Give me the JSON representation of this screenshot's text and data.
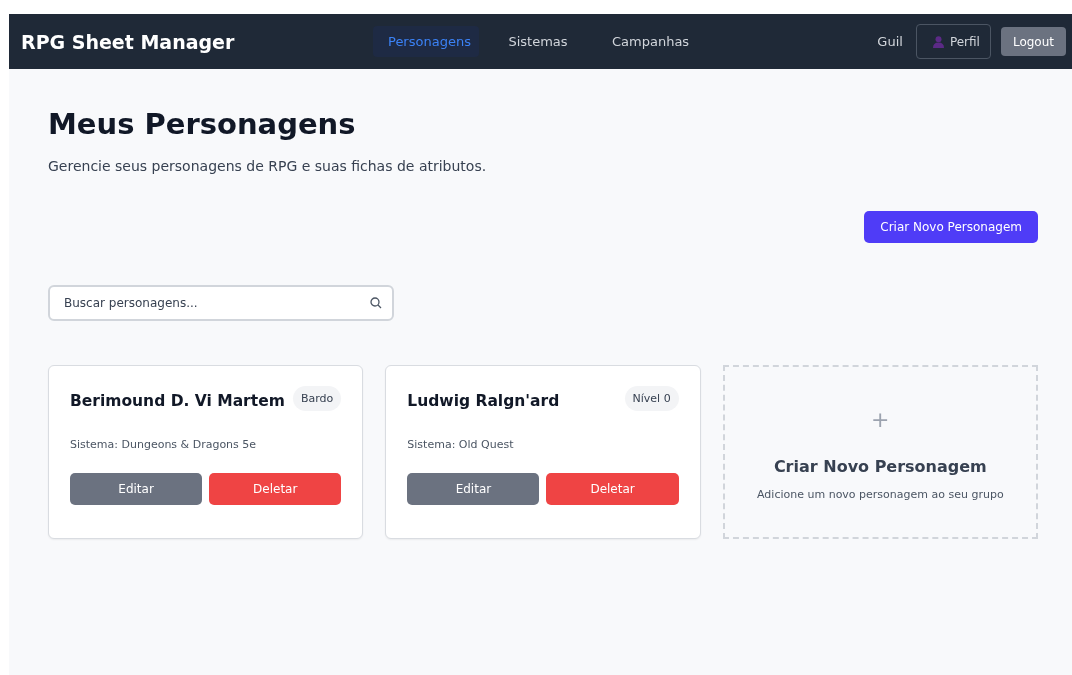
{
  "navbar": {
    "brand": "RPG Sheet Manager",
    "links": [
      {
        "label": "Personagens",
        "selected": true
      },
      {
        "label": "Sistemas",
        "selected": false
      },
      {
        "label": "Campanhas",
        "selected": false
      }
    ],
    "user": "Guil",
    "profile_button": "Perfil",
    "logout_button": "Logout"
  },
  "page": {
    "title": "Meus Personagens",
    "subtitle": "Gerencie seus personagens de RPG e suas fichas de atributos.",
    "create_button": "Criar Novo Personagem"
  },
  "search": {
    "placeholder": "Buscar personagens..."
  },
  "characters": [
    {
      "name": "Berimound D. Vi Martem",
      "badge": "Bardo",
      "system": "Sistema: Dungeons & Dragons 5e",
      "edit": "Editar",
      "delete": "Deletar"
    },
    {
      "name": "Ludwig Ralgn'ard",
      "badge": "Nível 0",
      "system": "Sistema: Old Quest",
      "edit": "Editar",
      "delete": "Deletar"
    }
  ],
  "new_card": {
    "symbol": "+",
    "title": "Criar Novo Personagem",
    "subtitle": "Adicione um novo personagem ao seu grupo"
  }
}
